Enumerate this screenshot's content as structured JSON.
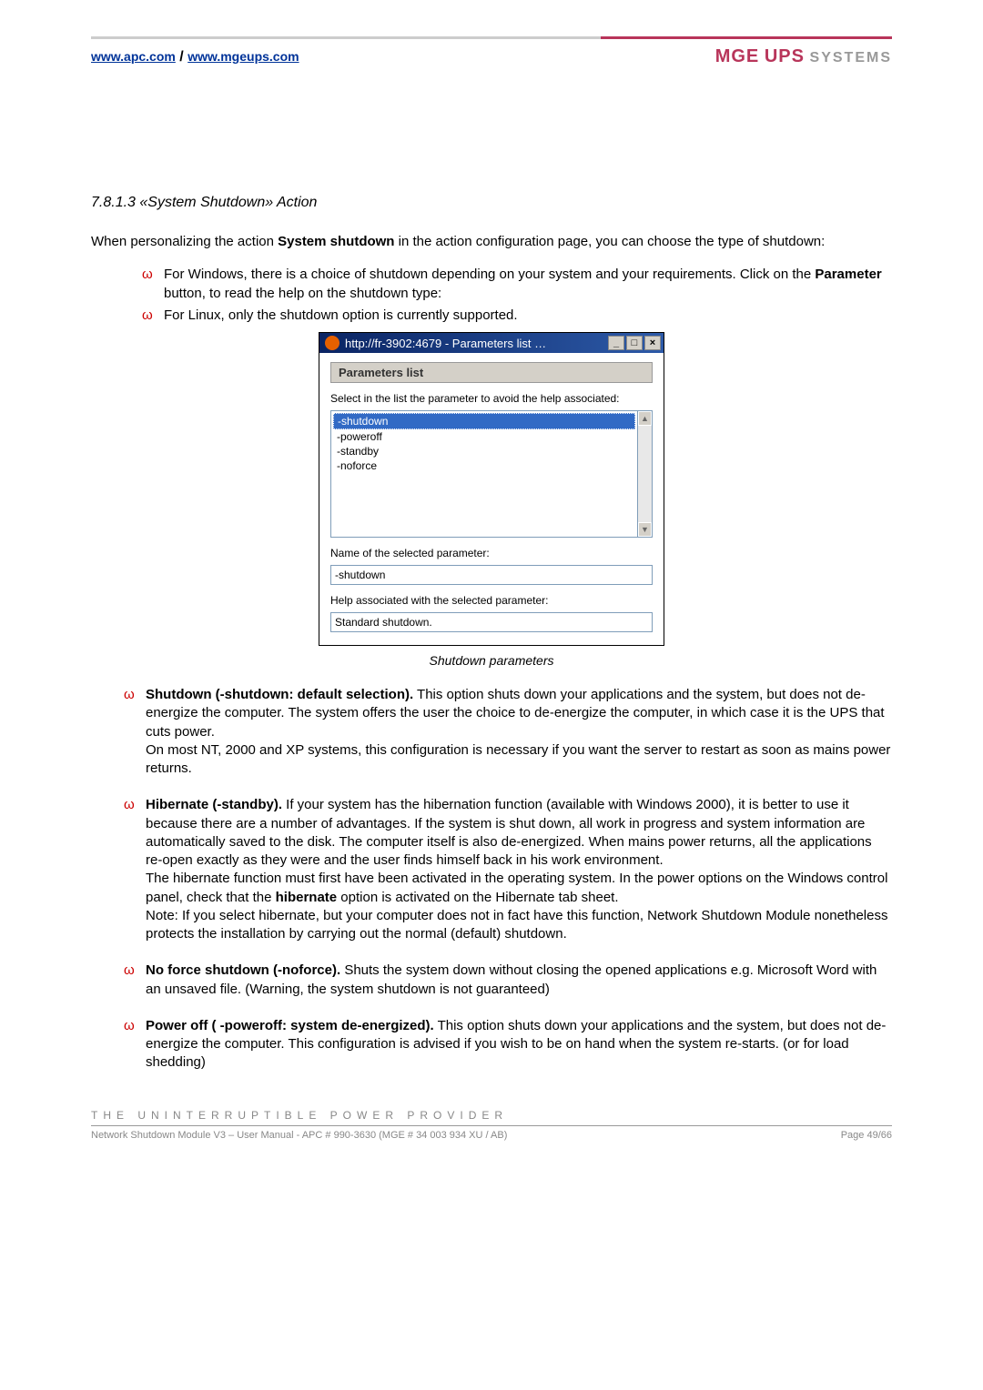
{
  "header": {
    "link1": "www.apc.com",
    "sep": " / ",
    "link2": "www.mgeups.com",
    "logo_mge": "MGE",
    "logo_ups": "UPS",
    "logo_sys": "SYSTEMS"
  },
  "section": {
    "number": "7.8.1.3    «System Shutdown» Action",
    "intro_pre": "When personalizing the action ",
    "intro_bold": "System shutdown",
    "intro_post": " in the action configuration page, you can choose the type of shutdown:"
  },
  "bullets": {
    "b1_pre": "For Windows, there is a choice of shutdown depending on your system and your requirements. Click on the ",
    "b1_bold": "Parameter",
    "b1_post": " button, to read the help on the shutdown type:",
    "b2": "For Linux, only the shutdown option is currently supported."
  },
  "dialog": {
    "title": "http://fr-3902:4679 - Parameters list …",
    "btn_min": "_",
    "btn_max": "□",
    "btn_close": "×",
    "groupbox_title": "Parameters list",
    "label_select": "Select in the list the parameter to avoid the help associated:",
    "options": [
      "-shutdown",
      "-poweroff",
      "-standby",
      "-noforce"
    ],
    "label_name": "Name of the selected parameter:",
    "value_name": "-shutdown",
    "label_help": "Help associated with the selected parameter:",
    "value_help": "Standard shutdown."
  },
  "caption": "Shutdown parameters",
  "opts": {
    "o1_bold": "Shutdown (-shutdown: default selection).",
    "o1_text": " This option shuts down your applications and the system, but does not de-energize the computer. The system offers the user the choice to de-energize the computer, in which case it is the UPS that cuts power.\nOn most NT, 2000 and XP systems, this configuration is necessary if you want the server to restart as soon as mains power returns.",
    "o2_bold": "Hibernate (-standby).",
    "o2_pre": " If your system has the hibernation function (available with Windows 2000), it is better to use it because there are a number of advantages. If the system is shut down, all work in progress and system information are automatically saved to the disk. The computer itself is also de-energized. When mains power returns, all the applications re-open exactly as they were and the user finds himself back in his work environment.\nThe hibernate function must first have been activated in the operating system. In the power options on the Windows control panel, check that the ",
    "o2_bold2": "hibernate",
    "o2_post": " option is activated on the Hibernate tab sheet.\nNote: If you select hibernate, but your computer does not in fact have this function, Network Shutdown Module nonetheless protects the installation by carrying out the normal (default) shutdown.",
    "o3_bold": "No force shutdown (-noforce).",
    "o3_text": " Shuts the system down without closing the opened applications e.g. Microsoft Word with an unsaved file. (Warning, the system shutdown is not guaranteed)",
    "o4_bold": "Power off ( -poweroff: system de-energized).",
    "o4_text": " This option shuts down your applications and the system, but does not de-energize the computer. This configuration is advised if you wish to be on hand when the system re-starts. (or for load shedding)"
  },
  "slogan": "THE UNINTERRUPTIBLE POWER PROVIDER",
  "footer": {
    "left": "Network Shutdown Module V3 – User Manual - APC # 990-3630 (MGE # 34 003 934 XU / AB)",
    "right": "Page 49/66"
  }
}
